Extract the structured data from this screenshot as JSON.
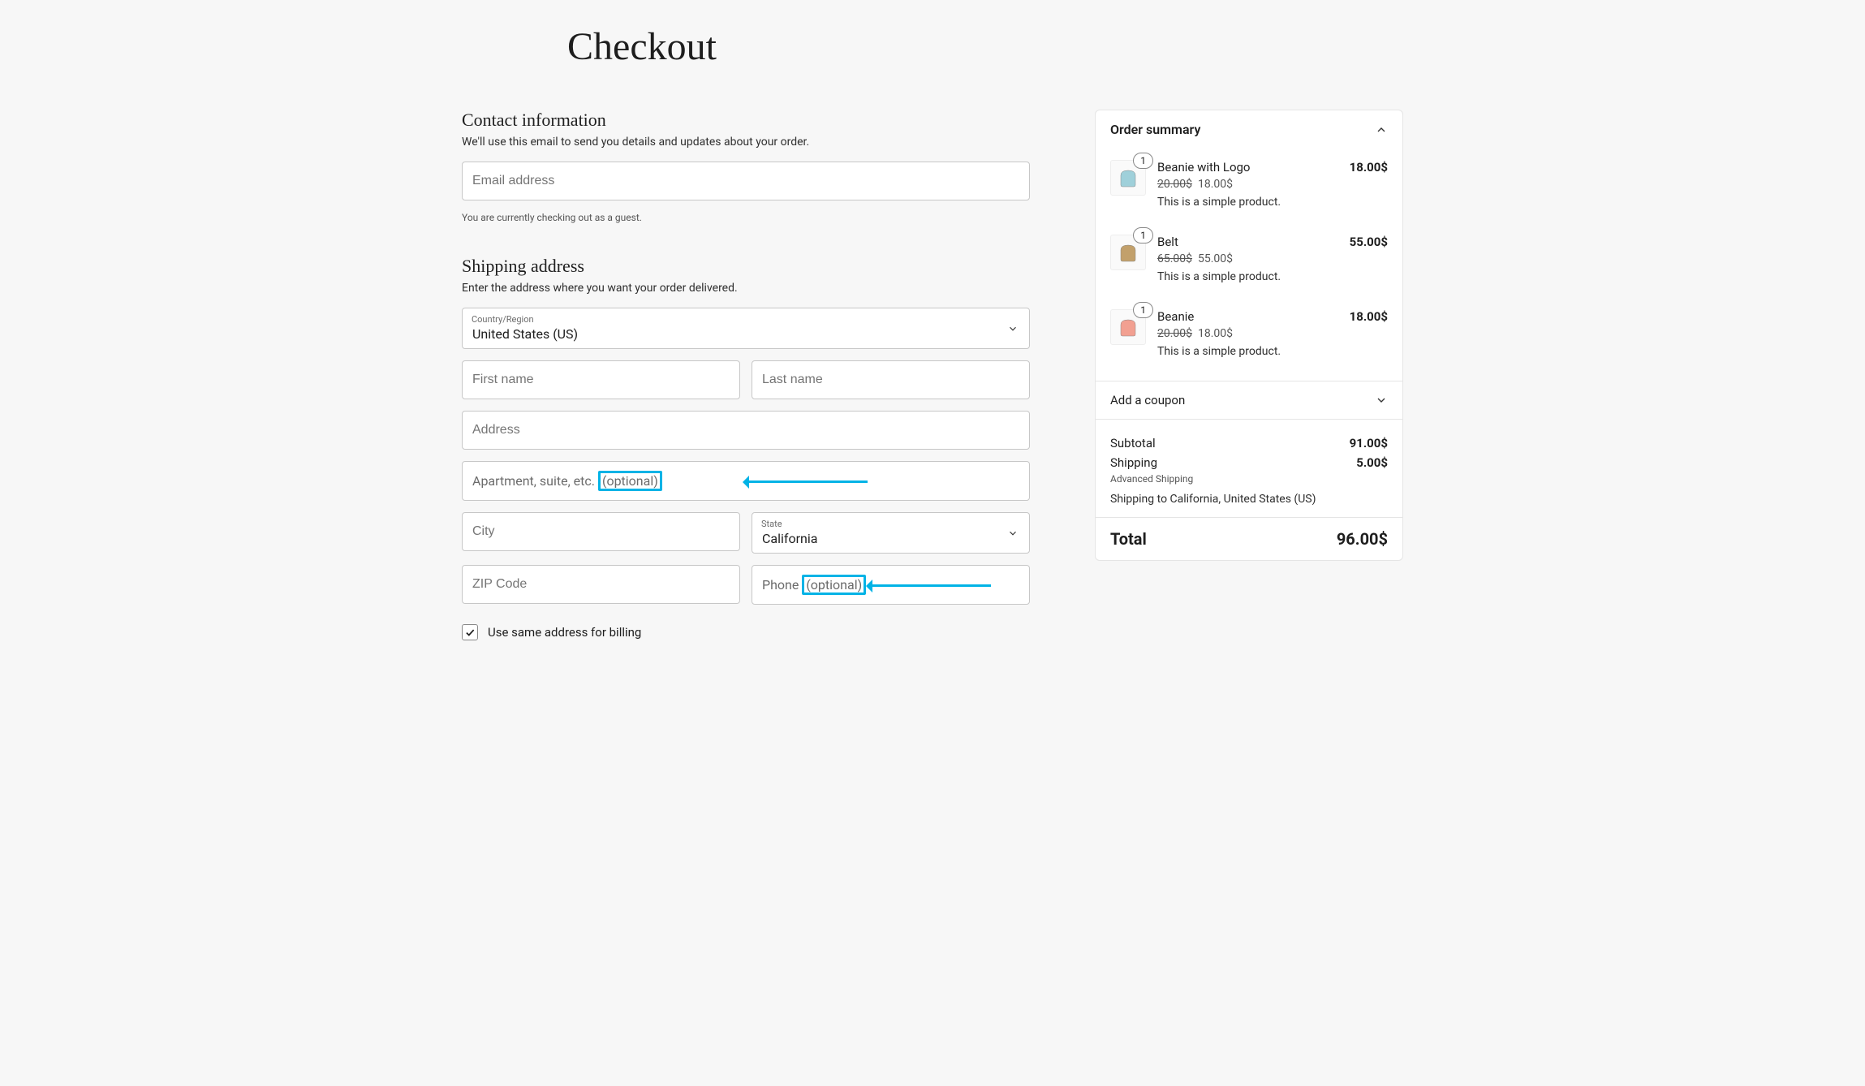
{
  "page_title": "Checkout",
  "contact": {
    "title": "Contact information",
    "desc": "We'll use this email to send you details and updates about your order.",
    "email_placeholder": "Email address",
    "guest_note": "You are currently checking out as a guest."
  },
  "shipping": {
    "title": "Shipping address",
    "desc": "Enter the address where you want your order delivered.",
    "country_label": "Country/Region",
    "country_value": "United States (US)",
    "first_name_ph": "First name",
    "last_name_ph": "Last name",
    "address_ph": "Address",
    "apt_ph_main": "Apartment, suite, etc. ",
    "apt_ph_opt": "(optional)",
    "city_ph": "City",
    "state_label": "State",
    "state_value": "California",
    "zip_ph": "ZIP Code",
    "phone_ph_main": "Phone ",
    "phone_ph_opt": "(optional)",
    "same_billing_label": "Use same address for billing",
    "same_billing_checked": true
  },
  "summary": {
    "title": "Order summary",
    "items": [
      {
        "qty": "1",
        "name": "Beanie with Logo",
        "total": "18.00$",
        "orig": "20.00$",
        "price": "18.00$",
        "desc": "This is a simple product.",
        "color": "#9fd0da"
      },
      {
        "qty": "1",
        "name": "Belt",
        "total": "55.00$",
        "orig": "65.00$",
        "price": "55.00$",
        "desc": "This is a simple product.",
        "color": "#c2a06b"
      },
      {
        "qty": "1",
        "name": "Beanie",
        "total": "18.00$",
        "orig": "20.00$",
        "price": "18.00$",
        "desc": "This is a simple product.",
        "color": "#f2a091"
      }
    ],
    "coupon_label": "Add a coupon",
    "subtotal_label": "Subtotal",
    "subtotal": "91.00$",
    "shipping_label": "Shipping",
    "shipping": "5.00$",
    "shipping_method": "Advanced Shipping",
    "shipping_to": "Shipping to California, United States (US)",
    "total_label": "Total",
    "total": "96.00$"
  }
}
